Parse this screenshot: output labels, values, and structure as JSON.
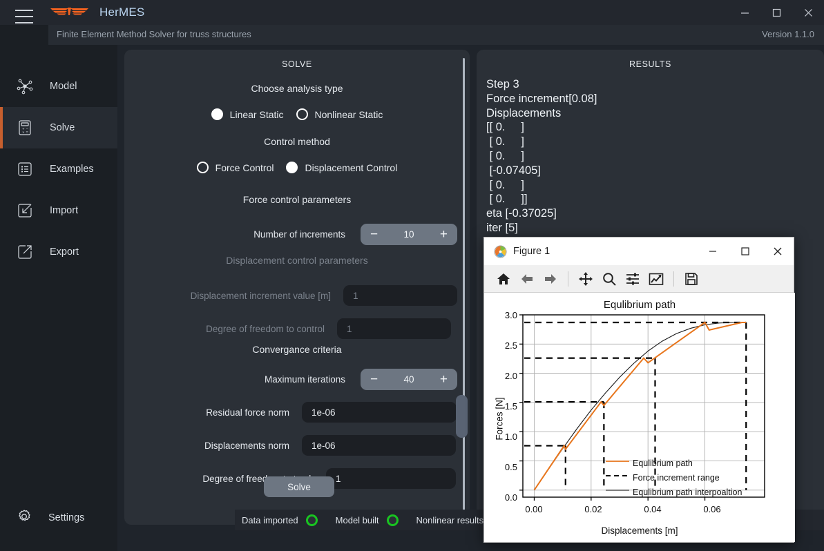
{
  "titlebar": {
    "app_name": "HerMES",
    "logo_color": "#f4621f",
    "minimize": "minimize-icon",
    "maximize": "maximize-icon",
    "close": "close-icon"
  },
  "subbar": {
    "subtitle": "Finite Element Method Solver for truss structures",
    "version": "Version 1.1.0"
  },
  "sidebar": {
    "items": [
      {
        "label": "Model",
        "icon": "network-nodes-icon",
        "active": false
      },
      {
        "label": "Solve",
        "icon": "calculator-icon",
        "active": true
      },
      {
        "label": "Examples",
        "icon": "list-box-icon",
        "active": false
      },
      {
        "label": "Import",
        "icon": "import-arrow-icon",
        "active": false
      },
      {
        "label": "Export",
        "icon": "export-arrow-icon",
        "active": false
      }
    ],
    "settings_label": "Settings",
    "settings_icon": "gear-icon",
    "active_accent": "#c75f2e"
  },
  "solve": {
    "title": "SOLVE",
    "analysis_heading": "Choose analysis type",
    "analysis_options": [
      {
        "label": "Linear Static",
        "selected": true
      },
      {
        "label": "Nonlinear Static",
        "selected": false
      }
    ],
    "control_heading": "Control method",
    "control_options": [
      {
        "label": "Force Control",
        "selected": false
      },
      {
        "label": "Displacement Control",
        "selected": true
      }
    ],
    "force_params_heading": "Force control parameters",
    "increments_label": "Number of increments",
    "increments_value": "10",
    "disp_params_heading": "Displacement control parameters",
    "disp_increment_label": "Displacement increment value [m]",
    "disp_increment_value": "1",
    "dof_control_label": "Degree of freedom to control",
    "dof_control_value": "1",
    "convergence_heading": "Convergance criteria",
    "max_iterations_label": "Maximum iterations",
    "max_iterations_value": "40",
    "residual_norm_label": "Residual force norm",
    "residual_norm_value": "1e-06",
    "disp_norm_label": "Displacements norm",
    "disp_norm_value": "1e-06",
    "dof_track_label": "Degree of freedom to track",
    "dof_track_value": "1",
    "solve_button": "Solve",
    "minus_label": "−",
    "plus_label": "+"
  },
  "results": {
    "title": "RESULTS",
    "text": "Step 3\nForce increment[0.08]\nDisplacements\n[[ 0.     ]\n [ 0.     ]\n [ 0.     ]\n [-0.07405]\n [ 0.     ]\n [ 0.     ]]\neta [-0.37025]\niter [5]"
  },
  "statusbar": {
    "items": [
      {
        "label": "Data imported",
        "state_color": "#19c421"
      },
      {
        "label": "Model built",
        "state_color": "#19c421"
      },
      {
        "label": "Nonlinear results ready",
        "state_color": "#19c421"
      }
    ]
  },
  "figure_window": {
    "title": "Figure 1",
    "window_icon": "matplotlib-icon",
    "minimize": "minimize-icon",
    "maximize": "maximize-icon",
    "close": "close-icon",
    "toolbar": [
      {
        "name": "home-icon"
      },
      {
        "name": "back-arrow-icon"
      },
      {
        "name": "forward-arrow-icon"
      },
      {
        "name": "pan-move-icon"
      },
      {
        "name": "zoom-magnifier-icon"
      },
      {
        "name": "configure-subplots-icon"
      },
      {
        "name": "edit-axis-curve-icon"
      },
      {
        "name": "save-floppy-icon"
      }
    ]
  },
  "chart_data": {
    "type": "line",
    "title": "Equlibrium path",
    "xlabel": "Displacements [m]",
    "ylabel": "Forces [N]",
    "xlim": [
      -0.004,
      0.081
    ],
    "ylim": [
      -0.12,
      3.0
    ],
    "xticks": [
      "0.00",
      "0.02",
      "0.04",
      "0.06"
    ],
    "xtick_values": [
      0.0,
      0.02,
      0.04,
      0.06
    ],
    "yticks": [
      "0.0",
      "0.5",
      "1.0",
      "1.5",
      "2.0",
      "2.5",
      "3.0"
    ],
    "ytick_values": [
      0.0,
      0.5,
      1.0,
      1.5,
      2.0,
      2.5,
      3.0
    ],
    "grid": true,
    "legend_position": "lower right",
    "series": [
      {
        "name": "Equlibrium path",
        "color": "#e8761d",
        "style": "solid",
        "x": [
          0.0,
          0.0105,
          0.011,
          0.0235,
          0.0245,
          0.0385,
          0.04,
          0.06,
          0.0615,
          0.073,
          0.0745
        ],
        "y": [
          0.0,
          0.76,
          0.7,
          1.51,
          1.45,
          2.26,
          2.18,
          2.87,
          2.74,
          2.87,
          2.87
        ]
      },
      {
        "name": "Equlibrium path interpoaltion",
        "color": "#1a1a1a",
        "style": "solid",
        "x": [
          0.0,
          0.005,
          0.01,
          0.015,
          0.02,
          0.025,
          0.03,
          0.035,
          0.04,
          0.045,
          0.05,
          0.055,
          0.06,
          0.065,
          0.07,
          0.0745
        ],
        "y": [
          0.0,
          0.36,
          0.71,
          1.05,
          1.37,
          1.66,
          1.93,
          2.17,
          2.38,
          2.55,
          2.68,
          2.77,
          2.83,
          2.86,
          2.87,
          2.87
        ]
      },
      {
        "name": "Force increment range",
        "color": "#000000",
        "style": "dashed",
        "hlines": [
          0.76,
          1.51,
          2.26,
          2.87
        ],
        "hline_xend": [
          0.011,
          0.0245,
          0.0425,
          0.0745
        ],
        "vlines": [
          0.011,
          0.0245,
          0.0425,
          0.0745
        ],
        "vline_ytop": [
          0.76,
          1.51,
          2.26,
          2.87
        ]
      }
    ],
    "legend": [
      "Equlibrium path",
      "Force increment range",
      "Equlibrium path interpoaltion"
    ]
  }
}
